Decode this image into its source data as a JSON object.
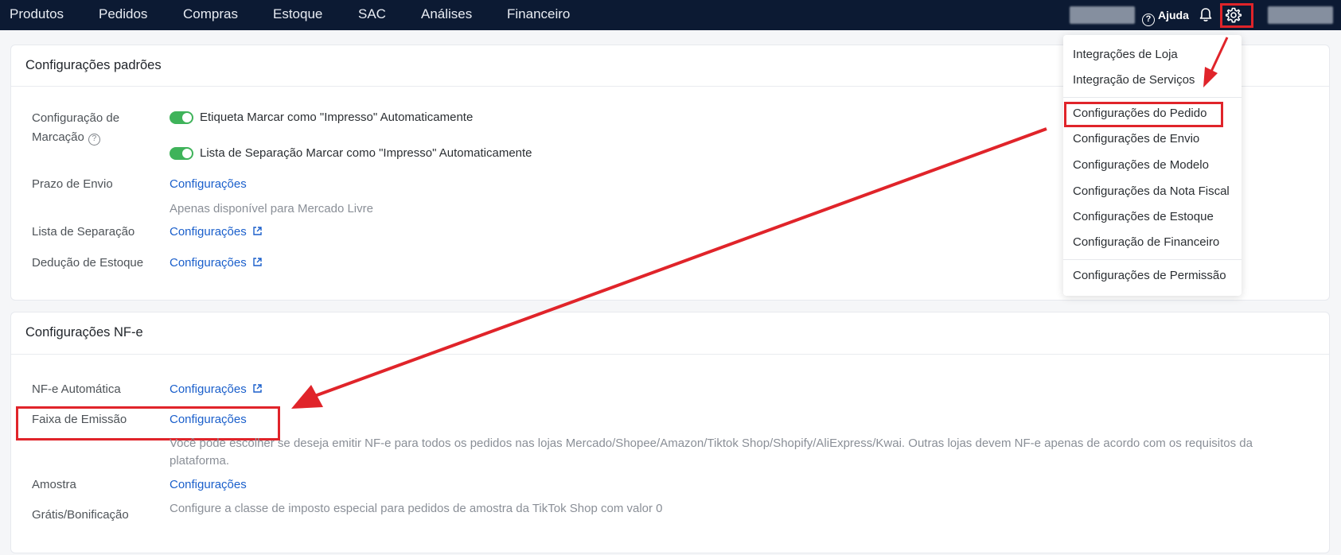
{
  "topnav": {
    "items": [
      "Produtos",
      "Pedidos",
      "Compras",
      "Estoque",
      "SAC",
      "Análises",
      "Financeiro"
    ],
    "help_label": "Ajuda",
    "icons": [
      "help-circle-icon",
      "bell-icon",
      "gear-icon"
    ]
  },
  "card_default": {
    "title": "Configurações padrões",
    "marking_label": "Configuração de Marcação",
    "toggle1_label": "Etiqueta Marcar como \"Impresso\" Automaticamente",
    "toggle2_label": "Lista de Separação Marcar como \"Impresso\" Automaticamente",
    "prazo_label": "Prazo de Envio",
    "prazo_link": "Configurações",
    "prazo_note": "Apenas disponível para Mercado Livre",
    "lista_label": "Lista de Separação",
    "lista_link": "Configurações",
    "deducao_label": "Dedução de Estoque",
    "deducao_link": "Configurações"
  },
  "card_nfe": {
    "title": "Configurações NF-e",
    "auto_label": "NF-e Automática",
    "auto_link": "Configurações",
    "faixa_label": "Faixa de Emissão",
    "faixa_link": "Configurações",
    "faixa_note": "Você pode escolher se deseja emitir NF-e para todos os pedidos nas lojas Mercado/Shopee/Amazon/Tiktok Shop/Shopify/AliExpress/Kwai. Outras lojas devem NF-e apenas de acordo com os requisitos da plataforma.",
    "amostra_label": "Amostra",
    "amostra_link": "Configurações",
    "gratis_label": "Grátis/Bonificação",
    "gratis_note": "Configure a classe de imposto especial para pedidos de amostra da TikTok Shop com valor 0"
  },
  "dropdown": {
    "items": [
      "Integrações de Loja",
      "Integração de Serviços",
      "Configurações do Pedido",
      "Configurações de Envio",
      "Configurações de Modelo",
      "Configurações da Nota Fiscal",
      "Configurações de Estoque",
      "Configuração de Financeiro",
      "Configurações de Permissão"
    ]
  },
  "colors": {
    "nav_bg": "#0c1a33",
    "link": "#1a5fcb",
    "toggle_on": "#3fb35a",
    "annotation_red": "#e0242a"
  }
}
